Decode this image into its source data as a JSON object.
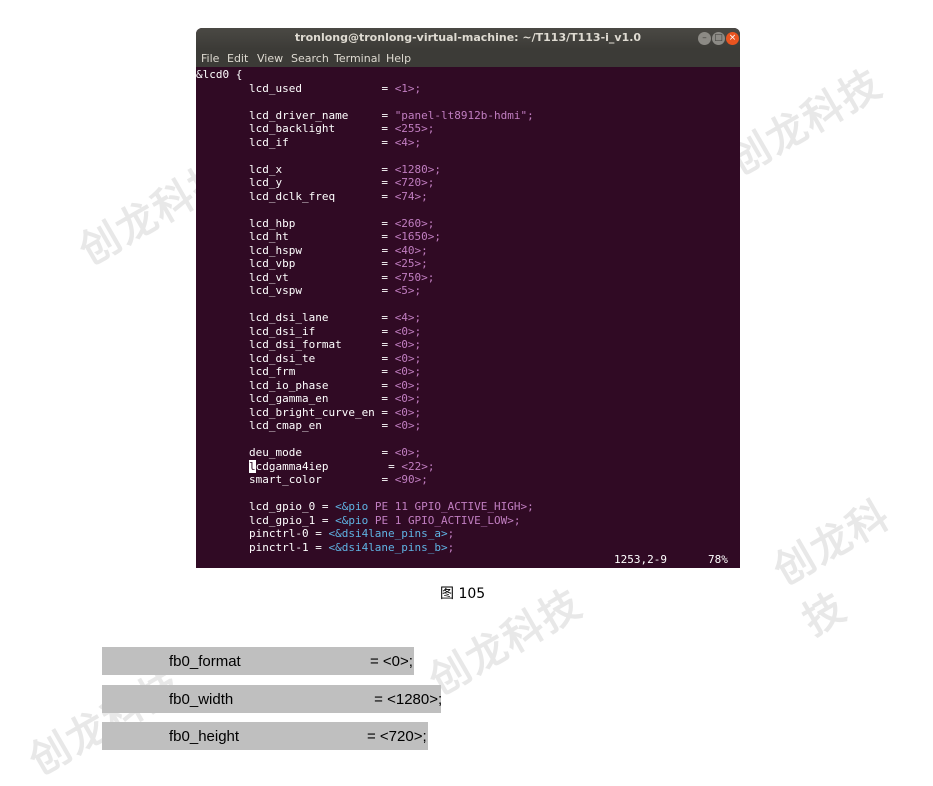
{
  "watermark": "创龙科技",
  "terminal": {
    "title": "tronlong@tronlong-virtual-machine: ~/T113/T113-i_v1.0",
    "menu": [
      "File",
      "Edit",
      "View",
      "Search",
      "Terminal",
      "Help"
    ],
    "lines": [
      {
        "name": "&lcd0 {",
        "eq": "",
        "val": ""
      },
      {
        "name": "        lcd_used",
        "eq": "            = ",
        "val": "<1>;"
      },
      {
        "name": "",
        "eq": "",
        "val": ""
      },
      {
        "name": "        lcd_driver_name",
        "eq": "     = ",
        "val": "\"panel-lt8912b-hdmi\";"
      },
      {
        "name": "        lcd_backlight",
        "eq": "       = ",
        "val": "<255>;"
      },
      {
        "name": "        lcd_if",
        "eq": "              = ",
        "val": "<4>;"
      },
      {
        "name": "",
        "eq": "",
        "val": ""
      },
      {
        "name": "        lcd_x",
        "eq": "               = ",
        "val": "<1280>;"
      },
      {
        "name": "        lcd_y",
        "eq": "               = ",
        "val": "<720>;"
      },
      {
        "name": "        lcd_dclk_freq",
        "eq": "       = ",
        "val": "<74>;"
      },
      {
        "name": "",
        "eq": "",
        "val": ""
      },
      {
        "name": "        lcd_hbp",
        "eq": "             = ",
        "val": "<260>;"
      },
      {
        "name": "        lcd_ht",
        "eq": "              = ",
        "val": "<1650>;"
      },
      {
        "name": "        lcd_hspw",
        "eq": "            = ",
        "val": "<40>;"
      },
      {
        "name": "        lcd_vbp",
        "eq": "             = ",
        "val": "<25>;"
      },
      {
        "name": "        lcd_vt",
        "eq": "              = ",
        "val": "<750>;"
      },
      {
        "name": "        lcd_vspw",
        "eq": "            = ",
        "val": "<5>;"
      },
      {
        "name": "",
        "eq": "",
        "val": ""
      },
      {
        "name": "        lcd_dsi_lane",
        "eq": "        = ",
        "val": "<4>;"
      },
      {
        "name": "        lcd_dsi_if",
        "eq": "          = ",
        "val": "<0>;"
      },
      {
        "name": "        lcd_dsi_format",
        "eq": "      = ",
        "val": "<0>;"
      },
      {
        "name": "        lcd_dsi_te",
        "eq": "          = ",
        "val": "<0>;"
      },
      {
        "name": "        lcd_frm",
        "eq": "             = ",
        "val": "<0>;"
      },
      {
        "name": "        lcd_io_phase",
        "eq": "        = ",
        "val": "<0>;"
      },
      {
        "name": "        lcd_gamma_en",
        "eq": "        = ",
        "val": "<0>;"
      },
      {
        "name": "        lcd_bright_curve_en",
        "eq": " = ",
        "val": "<0>;"
      },
      {
        "name": "        lcd_cmap_en",
        "eq": "         = ",
        "val": "<0>;"
      },
      {
        "name": "",
        "eq": "",
        "val": ""
      },
      {
        "name": "        deu_mode",
        "eq": "            = ",
        "val": "<0>;"
      },
      {
        "name": "cdgamma4iep",
        "eq": "         = ",
        "val": "<22>;",
        "cursor": "l"
      },
      {
        "name": "        smart_color",
        "eq": "         = ",
        "val": "<90>;"
      },
      {
        "name": "",
        "eq": "",
        "val": ""
      },
      {
        "name": "        lcd_gpio_0 = ",
        "ref": "<&pio",
        "val": " PE 11 GPIO_ACTIVE_HIGH>;"
      },
      {
        "name": "        lcd_gpio_1 = ",
        "ref": "<&pio",
        "val": " PE 1 GPIO_ACTIVE_LOW>;"
      },
      {
        "name": "        pinctrl-0 = ",
        "ref": "<&dsi4lane_pins_a>",
        "val": ";"
      },
      {
        "name": "        pinctrl-1 = ",
        "ref": "<&dsi4lane_pins_b>",
        "val": ";"
      }
    ],
    "status": {
      "position": "1253,2-9",
      "percent": "78%"
    }
  },
  "caption": "图 105",
  "highlights": [
    {
      "name": "fb0_format",
      "value": "= <0>;"
    },
    {
      "name": "fb0_width",
      "value": " = <1280>;"
    },
    {
      "name": "fb0_height",
      "value": "= <720>;"
    }
  ]
}
